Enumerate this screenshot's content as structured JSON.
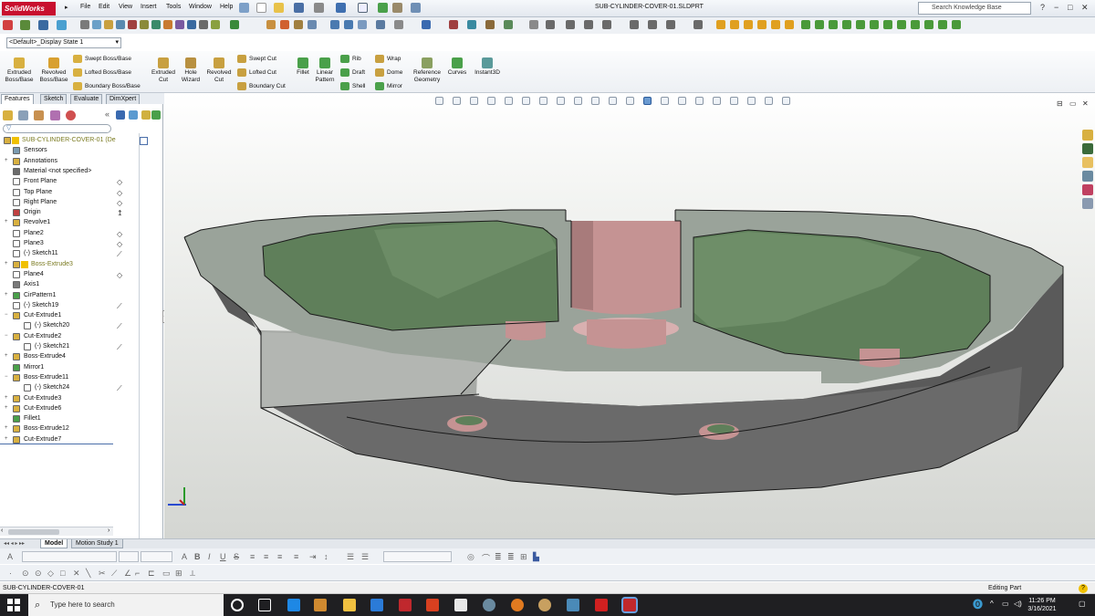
{
  "app": {
    "logo_text": "SolidWorks",
    "document_title": "SUB-CYLINDER-COVER-01.SLDPRT"
  },
  "menu": [
    "File",
    "Edit",
    "View",
    "Insert",
    "Tools",
    "Window",
    "Help"
  ],
  "search": {
    "placeholder": "Search Knowledge Base"
  },
  "window_controls": [
    "?",
    "−",
    "□",
    "✕"
  ],
  "configuration": {
    "value": "<Default>_Display State 1"
  },
  "command_manager": {
    "large_buttons": [
      {
        "label": "Extruded Boss/Base",
        "icon": "extruded-boss-icon"
      },
      {
        "label": "Revolved Boss/Base",
        "icon": "revolved-boss-icon"
      },
      {
        "label": "Extruded Cut",
        "icon": "extruded-cut-icon"
      },
      {
        "label": "Hole Wizard",
        "icon": "hole-wizard-icon"
      },
      {
        "label": "Revolved Cut",
        "icon": "revolved-cut-icon"
      },
      {
        "label": "Fillet",
        "icon": "fillet-icon"
      },
      {
        "label": "Linear Pattern",
        "icon": "linear-pattern-icon"
      },
      {
        "label": "Reference Geometry",
        "icon": "reference-geometry-icon"
      },
      {
        "label": "Curves",
        "icon": "curves-icon"
      },
      {
        "label": "Instant3D",
        "icon": "instant3d-icon"
      }
    ],
    "small_buttons": [
      {
        "label": "Swept Boss/Base"
      },
      {
        "label": "Lofted Boss/Base"
      },
      {
        "label": "Boundary Boss/Base"
      },
      {
        "label": "Swept Cut"
      },
      {
        "label": "Lofted Cut"
      },
      {
        "label": "Boundary Cut"
      },
      {
        "label": "Rib"
      },
      {
        "label": "Draft"
      },
      {
        "label": "Shell"
      },
      {
        "label": "Wrap"
      },
      {
        "label": "Dome"
      },
      {
        "label": "Mirror"
      }
    ]
  },
  "panel_tabs": [
    "Features",
    "Sketch",
    "Evaluate",
    "DimXpert"
  ],
  "feature_tree": [
    {
      "label": "SUB-CYLINDER-COVER-01  (De",
      "icon": "part-icon",
      "expander": "",
      "warn": true,
      "depth": 0,
      "greyed": true
    },
    {
      "label": "Sensors",
      "icon": "sensor-icon",
      "expander": "",
      "depth": 1
    },
    {
      "label": "Annotations",
      "icon": "annotation-icon",
      "expander": "+",
      "depth": 1
    },
    {
      "label": "Material <not specified>",
      "icon": "material-icon",
      "expander": "",
      "depth": 1
    },
    {
      "label": "Front Plane",
      "icon": "plane-icon",
      "expander": "",
      "depth": 1
    },
    {
      "label": "Top Plane",
      "icon": "plane-icon",
      "expander": "",
      "depth": 1
    },
    {
      "label": "Right Plane",
      "icon": "plane-icon",
      "expander": "",
      "depth": 1
    },
    {
      "label": "Origin",
      "icon": "origin-icon",
      "expander": "",
      "depth": 1
    },
    {
      "label": "Revolve1",
      "icon": "revolve-icon",
      "expander": "+",
      "depth": 1
    },
    {
      "label": "Plane2",
      "icon": "plane-icon",
      "expander": "",
      "depth": 1
    },
    {
      "label": "Plane3",
      "icon": "plane-icon",
      "expander": "",
      "depth": 1
    },
    {
      "label": "(-) Sketch11",
      "icon": "sketch-icon",
      "expander": "",
      "depth": 1
    },
    {
      "label": "Boss-Extrude3",
      "icon": "extrude-icon",
      "expander": "+",
      "depth": 1,
      "warn": true,
      "greyed": true
    },
    {
      "label": "Plane4",
      "icon": "plane-icon",
      "expander": "",
      "depth": 1
    },
    {
      "label": "Axis1",
      "icon": "axis-icon",
      "expander": "",
      "depth": 1
    },
    {
      "label": "CirPattern1",
      "icon": "pattern-icon",
      "expander": "+",
      "depth": 1
    },
    {
      "label": "(-) Sketch19",
      "icon": "sketch-icon",
      "expander": "",
      "depth": 1
    },
    {
      "label": "Cut-Extrude1",
      "icon": "extrude-icon",
      "expander": "−",
      "depth": 1
    },
    {
      "label": "(-) Sketch20",
      "icon": "sketch-icon",
      "expander": "",
      "depth": 2
    },
    {
      "label": "Cut-Extrude2",
      "icon": "extrude-icon",
      "expander": "−",
      "depth": 1
    },
    {
      "label": "(-) Sketch21",
      "icon": "sketch-icon",
      "expander": "",
      "depth": 2
    },
    {
      "label": "Boss-Extrude4",
      "icon": "extrude-icon",
      "expander": "+",
      "depth": 1
    },
    {
      "label": "Mirror1",
      "icon": "mirror-icon",
      "expander": "",
      "depth": 1
    },
    {
      "label": "Boss-Extrude11",
      "icon": "extrude-icon",
      "expander": "−",
      "depth": 1
    },
    {
      "label": "(-) Sketch24",
      "icon": "sketch-icon",
      "expander": "",
      "depth": 2
    },
    {
      "label": "Cut-Extrude3",
      "icon": "extrude-icon",
      "expander": "+",
      "depth": 1
    },
    {
      "label": "Cut-Extrude6",
      "icon": "extrude-icon",
      "expander": "+",
      "depth": 1
    },
    {
      "label": "Fillet1",
      "icon": "fillet-icon",
      "expander": "",
      "depth": 1
    },
    {
      "label": "Boss-Extrude12",
      "icon": "extrude-icon",
      "expander": "+",
      "depth": 1
    },
    {
      "label": "Cut-Extrude7",
      "icon": "extrude-icon",
      "expander": "+",
      "depth": 1
    }
  ],
  "bottom_tabs": [
    "Model",
    "Motion Study 1"
  ],
  "status": {
    "left": "SUB-CYLINDER-COVER-01",
    "right": "Editing Part",
    "help": "?"
  },
  "taskbar": {
    "search_placeholder": "Type here to search",
    "time": "11:26 PM",
    "date": "3/16/2021"
  },
  "colors": {
    "brand": "#c8102e",
    "section_face": "#9aa39a",
    "pocket_green": "#5f7f5a",
    "boss_pink": "#c59393",
    "base_grey": "#585858"
  }
}
